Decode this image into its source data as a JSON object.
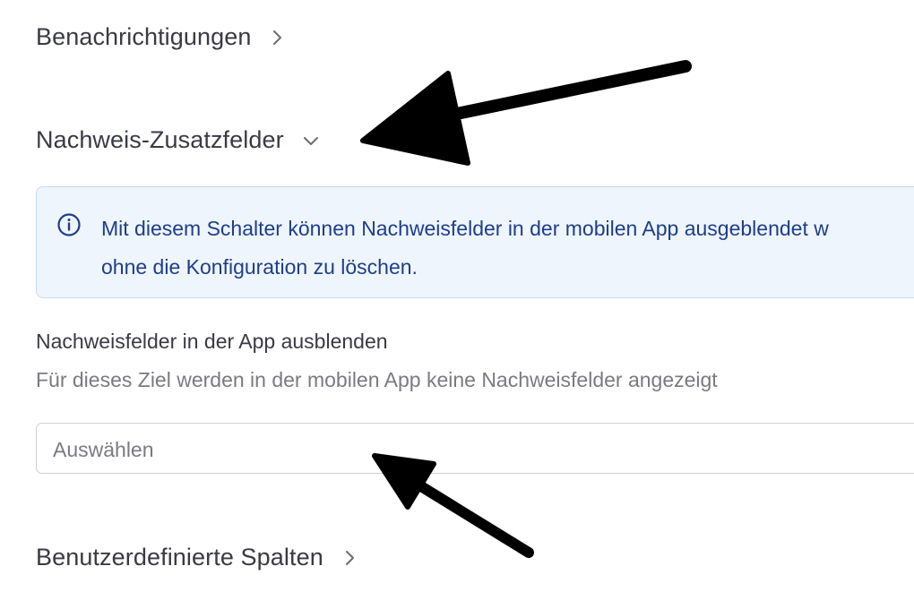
{
  "sections": {
    "notifications": {
      "title": "Benachrichtigungen",
      "state_icon": "chevron-right-icon"
    },
    "proof_fields": {
      "title": "Nachweis-Zusatzfelder",
      "state_icon": "chevron-down-icon"
    },
    "custom_columns": {
      "title": "Benutzerdefinierte Spalten",
      "state_icon": "chevron-right-icon"
    }
  },
  "info": {
    "icon": "info-icon",
    "line1": "Mit diesem Schalter können Nachweisfelder in der mobilen App ausgeblendet w",
    "line2": "ohne die Konfiguration zu löschen."
  },
  "hide_fields": {
    "label": "Nachweisfelder in der App ausblenden",
    "description": "Für dieses Ziel werden in der mobilen App keine Nachweisfelder angezeigt",
    "placeholder": "Auswählen"
  },
  "colors": {
    "info_background": "#eef5fd",
    "info_text": "#1f3e8a",
    "annotation_arrow": "#000000"
  }
}
